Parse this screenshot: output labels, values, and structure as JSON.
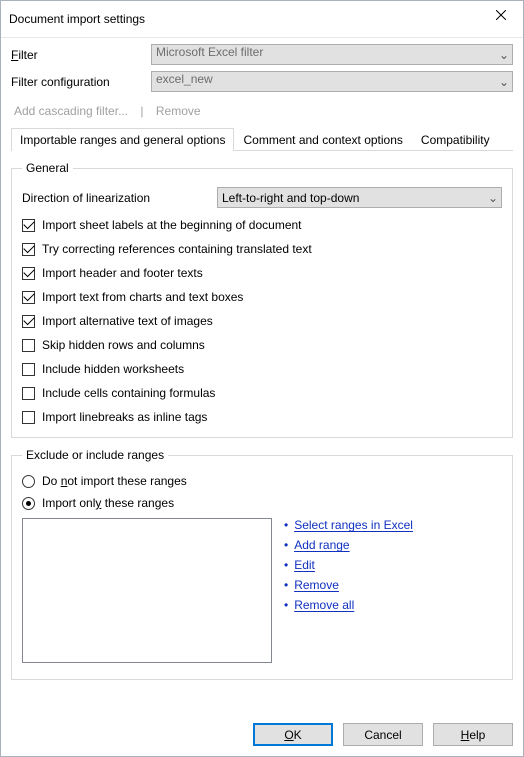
{
  "title": "Document import settings",
  "rows": {
    "filter_label": "Filter",
    "filter_value": "Microsoft Excel filter",
    "filterconf_label": "Filter configuration",
    "filterconf_value": "excel_new",
    "add_cascading": "Add cascading filter...",
    "remove_link": "Remove"
  },
  "tabs": {
    "t1": "Importable ranges and general options",
    "t2": "Comment and context options",
    "t3": "Compatibility"
  },
  "general": {
    "legend": "General",
    "dir_label": "Direction of linearization",
    "dir_value": "Left-to-right and top-down",
    "c1": "Import sheet labels at the beginning of document",
    "c2": "Try correcting references containing translated text",
    "c3": "Import header and footer texts",
    "c4": "Import text from charts and text boxes",
    "c5": "Import alternative text of images",
    "c6": "Skip hidden rows and columns",
    "c7": "Include hidden worksheets",
    "c8": "Include cells containing formulas",
    "c9": "Import linebreaks as inline tags"
  },
  "ranges": {
    "legend": "Exclude or include ranges",
    "r1": "Do not import these ranges",
    "r2": "Import only these ranges",
    "l1": "Select ranges in Excel",
    "l2": "Add range",
    "l3": "Edit",
    "l4": "Remove",
    "l5": "Remove all"
  },
  "buttons": {
    "ok": "OK",
    "cancel": "Cancel",
    "help": "Help"
  }
}
